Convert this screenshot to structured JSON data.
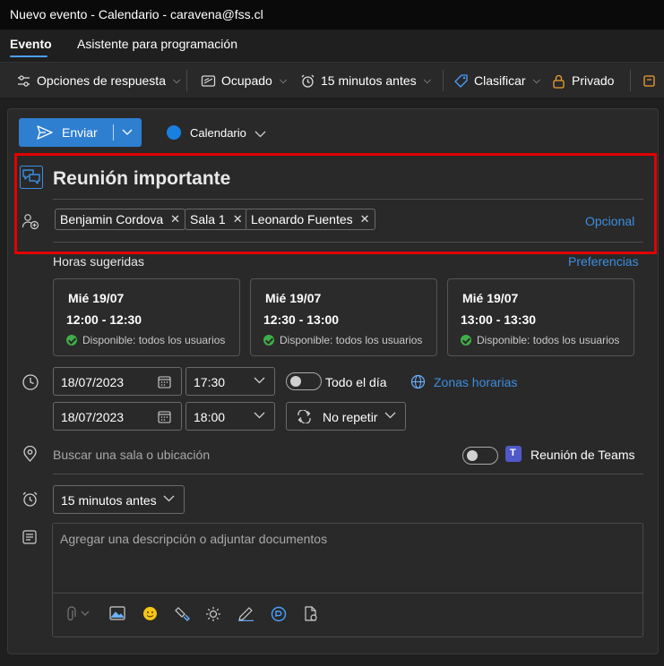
{
  "window": {
    "title": "Nuevo evento - Calendario - caravena@fss.cl"
  },
  "tabs": [
    {
      "label": "Evento",
      "active": true
    },
    {
      "label": "Asistente para programación",
      "active": false
    }
  ],
  "ribbon": {
    "response_options": "Opciones de respuesta",
    "show_as": "Ocupado",
    "reminder": "15 minutos antes",
    "categorize": "Clasificar",
    "private": "Privado"
  },
  "actions": {
    "send_label": "Enviar",
    "calendar_label": "Calendario",
    "calendar_color": "#1a80e0"
  },
  "event": {
    "title": "Reunión importante",
    "attendees": [
      {
        "name": "Benjamin Cordova"
      },
      {
        "name": "Sala 1"
      },
      {
        "name": "Leonardo Fuentes"
      }
    ],
    "optional_label": "Opcional"
  },
  "suggested": {
    "label": "Horas sugeridas",
    "preferences_label": "Preferencias",
    "slots": [
      {
        "day": "Mié 19/07",
        "time": "12:00 - 12:30",
        "availability": "Disponible: todos los usuarios"
      },
      {
        "day": "Mié 19/07",
        "time": "12:30 - 13:00",
        "availability": "Disponible: todos los usuarios"
      },
      {
        "day": "Mié 19/07",
        "time": "13:00 - 13:30",
        "availability": "Disponible: todos los usuarios"
      }
    ]
  },
  "datetime": {
    "start_date": "18/07/2023",
    "start_time": "17:30",
    "end_date": "18/07/2023",
    "end_time": "18:00",
    "all_day_label": "Todo el día",
    "all_day": false,
    "timezones_label": "Zonas horarias",
    "repeat_label": "No repetir"
  },
  "location": {
    "placeholder": "Buscar una sala o ubicación",
    "teams_label": "Reunión de Teams",
    "teams_meeting": false
  },
  "reminder": {
    "value": "15 minutos antes"
  },
  "description": {
    "placeholder": "Agregar una descripción o adjuntar documentos"
  },
  "colors": {
    "accent": "#2f7fd1",
    "link": "#3c8ee0",
    "highlight": "#e30000",
    "available": "#3fae49"
  }
}
